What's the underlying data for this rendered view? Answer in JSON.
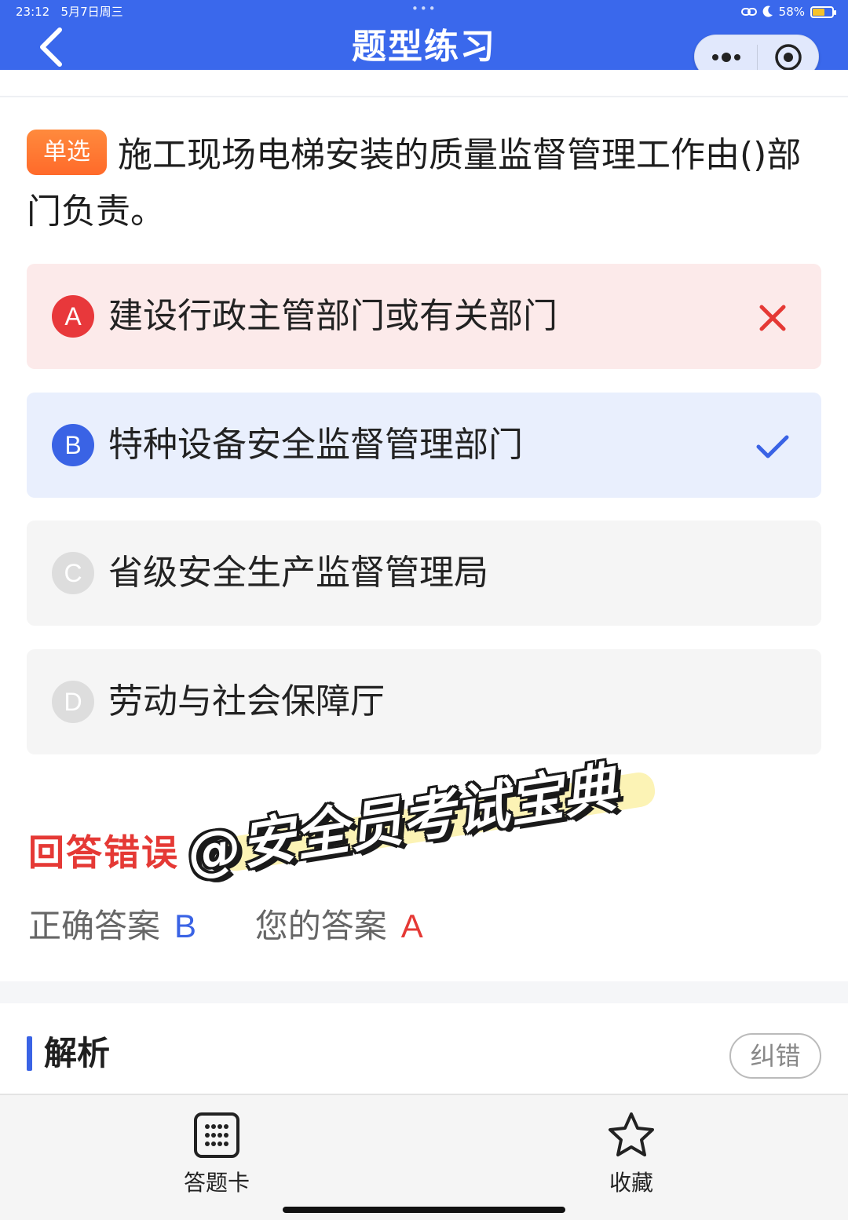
{
  "status_bar": {
    "time": "23:12",
    "date": "5月7日周三",
    "battery": "58%"
  },
  "header": {
    "title": "题型练习",
    "back_icon": "chevron-left-icon",
    "more_icon": "more-dots-icon",
    "close_icon": "target-circle-icon"
  },
  "question": {
    "type_label": "单选",
    "text": "施工现场电梯安装的质量监督管理工作由()部门负责。"
  },
  "options": [
    {
      "letter": "A",
      "text": "建设行政主管部门或有关部门",
      "state": "wrong",
      "mark_icon": "cross-icon"
    },
    {
      "letter": "B",
      "text": "特种设备安全监督管理部门",
      "state": "correct",
      "mark_icon": "check-icon"
    },
    {
      "letter": "C",
      "text": "省级安全生产监督管理局",
      "state": "neutral"
    },
    {
      "letter": "D",
      "text": "劳动与社会保障厅",
      "state": "neutral"
    }
  ],
  "result": {
    "title": "回答错误",
    "correct_label": "正确答案",
    "correct_value": "B",
    "your_label": "您的答案",
    "your_value": "A"
  },
  "watermark": {
    "text": "@安全员考试宝典"
  },
  "analysis": {
    "title": "解析",
    "report_label": "纠错"
  },
  "bottom_nav": {
    "answer_card_label": "答题卡",
    "favorite_label": "收藏"
  },
  "colors": {
    "header_blue": "#3a68ec",
    "wrong_red": "#e53935",
    "correct_blue": "#3a63e5",
    "badge_orange": "#ff7a33"
  }
}
